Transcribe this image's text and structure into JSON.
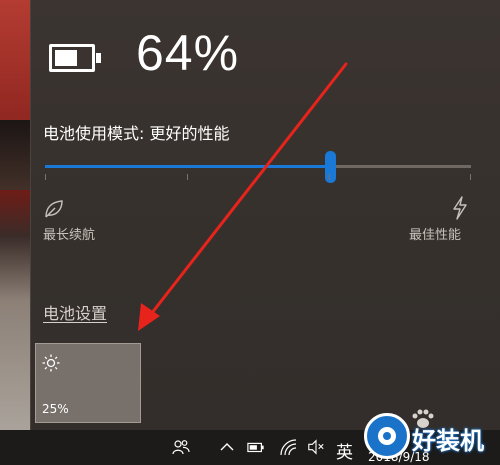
{
  "battery": {
    "percent_text": "64%",
    "level": 0.64
  },
  "power_mode": {
    "label": "电池使用模式: 更好的性能",
    "slider_value": 0.67,
    "left_label": "最长续航",
    "right_label": "最佳性能",
    "left_icon": "leaf-icon",
    "right_icon": "lightning-icon"
  },
  "settings_link": "电池设置",
  "brightness": {
    "icon": "sun-icon",
    "value": "25%"
  },
  "taskbar": {
    "ime": "英",
    "date_partial": "2018/9/18",
    "icons": [
      "people-icon",
      "chevron-up-icon",
      "battery-icon",
      "wifi-icon",
      "volume-muted-icon"
    ]
  },
  "watermark": {
    "brand": "好装机"
  },
  "colors": {
    "accent": "#1a78d6",
    "flyout_bg": "#38312d",
    "annotation_arrow": "#e8231c"
  }
}
